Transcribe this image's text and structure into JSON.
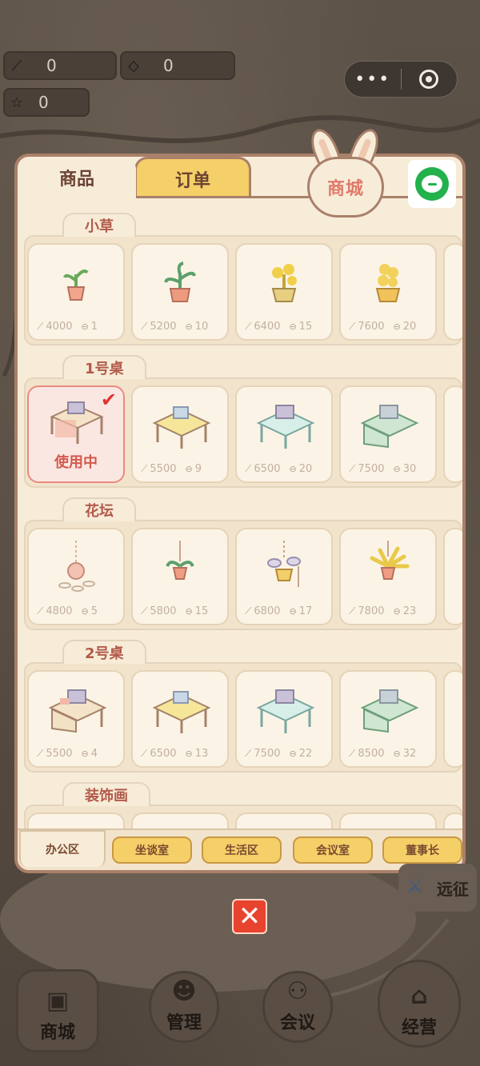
{
  "resources": [
    {
      "icon": "carrot-icon",
      "value": "0"
    },
    {
      "icon": "diamond-icon",
      "value": "0"
    },
    {
      "icon": "star-icon",
      "value": "0"
    }
  ],
  "capsule": {
    "more": "•••"
  },
  "shop": {
    "tabs": {
      "goods": "商品",
      "orders": "订单"
    },
    "badge": "商城",
    "sections": [
      {
        "title": "小草",
        "items": [
          {
            "price": "4000",
            "level": "1"
          },
          {
            "price": "5200",
            "level": "10"
          },
          {
            "price": "6400",
            "level": "15"
          },
          {
            "price": "7600",
            "level": "20"
          }
        ]
      },
      {
        "title": "1号桌",
        "items": [
          {
            "status": "使用中"
          },
          {
            "price": "5500",
            "level": "9"
          },
          {
            "price": "6500",
            "level": "20"
          },
          {
            "price": "7500",
            "level": "30"
          }
        ]
      },
      {
        "title": "花坛",
        "items": [
          {
            "price": "4800",
            "level": "5"
          },
          {
            "price": "5800",
            "level": "15"
          },
          {
            "price": "6800",
            "level": "17"
          },
          {
            "price": "7800",
            "level": "23"
          }
        ]
      },
      {
        "title": "2号桌",
        "items": [
          {
            "price": "5500",
            "level": "4"
          },
          {
            "price": "6500",
            "level": "13"
          },
          {
            "price": "7500",
            "level": "22"
          },
          {
            "price": "8500",
            "level": "32"
          }
        ]
      },
      {
        "title": "装饰画",
        "items": []
      }
    ],
    "categories": [
      "办公区",
      "坐谈室",
      "生活区",
      "会议室",
      "董事长"
    ],
    "close_symbol": "✕"
  },
  "side": {
    "expedition": "远征"
  },
  "nav": {
    "shop": "商城",
    "manage": "管理",
    "meeting": "会议",
    "business": "经营"
  },
  "colors": {
    "accent_yellow": "#f5cf68",
    "panel_bg": "#f7ecd8",
    "border_brown": "#a9806a",
    "using_red": "#d45a4e",
    "close_red": "#e8432f"
  }
}
